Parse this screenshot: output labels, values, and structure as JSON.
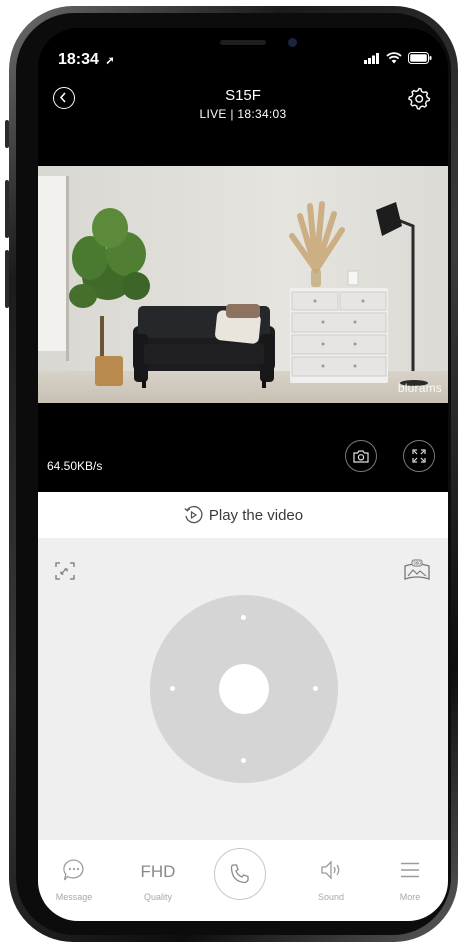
{
  "status_bar": {
    "time": "18:34"
  },
  "header": {
    "title": "S15F",
    "subtitle": "LIVE | 18:34:03"
  },
  "video": {
    "watermark": "blurams"
  },
  "stream": {
    "speed": "64.50KB/s"
  },
  "playback": {
    "label": "Play the video"
  },
  "ptz": {
    "mode_badge": "360"
  },
  "tabbar": {
    "message": "Message",
    "quality_value": "FHD",
    "quality": "Quality",
    "sound": "Sound",
    "more": "More"
  },
  "colors": {
    "screen_bg": "#000000",
    "ptz_bg": "#efefef",
    "pad": "#d5d5d5",
    "tab_label": "#a8a8a8"
  },
  "icons": [
    "back-icon",
    "gear-icon",
    "camera-snapshot-icon",
    "fullscreen-icon",
    "replay-icon",
    "zoom-mode-icon",
    "panorama-360-icon",
    "message-icon",
    "phone-icon",
    "speaker-icon",
    "menu-icon"
  ]
}
